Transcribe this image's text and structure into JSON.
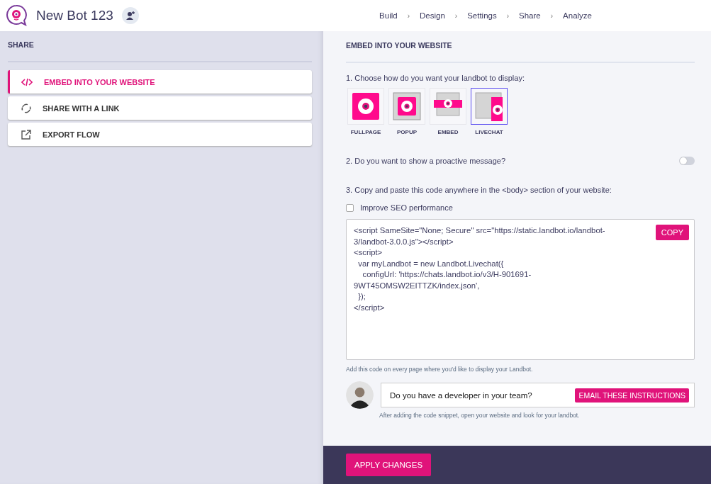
{
  "header": {
    "title": "New Bot 123",
    "steps": [
      {
        "label": "Build"
      },
      {
        "label": "Design"
      },
      {
        "label": "Settings"
      },
      {
        "label": "Share"
      },
      {
        "label": "Analyze"
      }
    ],
    "separator": "›"
  },
  "sidebar": {
    "title": "SHARE",
    "items": [
      {
        "kind": "code",
        "label": "EMBED INTO YOUR WEBSITE",
        "selected": true
      },
      {
        "kind": "link",
        "label": "SHARE WITH A LINK",
        "selected": false
      },
      {
        "kind": "export",
        "label": "EXPORT FLOW",
        "selected": false
      }
    ]
  },
  "panel": {
    "title": "EMBED INTO YOUR WEBSITE",
    "step1": "1. Choose how do you want your landbot to display:",
    "display_options": [
      {
        "kind": "fullpage",
        "label": "FULLPAGE",
        "selected": false
      },
      {
        "kind": "popup",
        "label": "POPUP",
        "selected": false
      },
      {
        "kind": "embed",
        "label": "EMBED",
        "selected": false
      },
      {
        "kind": "livechat",
        "label": "LIVECHAT",
        "selected": true
      }
    ],
    "step2": "2. Do you want to show a proactive message?",
    "proactive_toggle": {
      "on": false
    },
    "step3": "3. Copy and paste this code anywhere in the <body> section of your website:",
    "seo": {
      "label": "Improve SEO performance",
      "checked": false
    },
    "code_lines": [
      "<script SameSite=\"None; Secure\" src=\"https://static.landbot.io/landbot-",
      "3/landbot-3.0.0.js\"></script>",
      "<script>",
      "  var myLandbot = new Landbot.Livechat({",
      "    configUrl: 'https://chats.landbot.io/v3/H-901691-",
      "9WT45OMSW2EITTZK/index.json',",
      "  });",
      "</script>"
    ],
    "copy_button": "COPY",
    "hint": "Add this code on every page where you'd like to display your Landbot.",
    "developer_question": "Do you have a developer in your team?",
    "email_button": "EMAIL THESE INSTRUCTIONS",
    "after_hint": "After adding the code snippet, open your website and look for your landbot."
  },
  "apply_button": "APPLY CHANGES"
}
